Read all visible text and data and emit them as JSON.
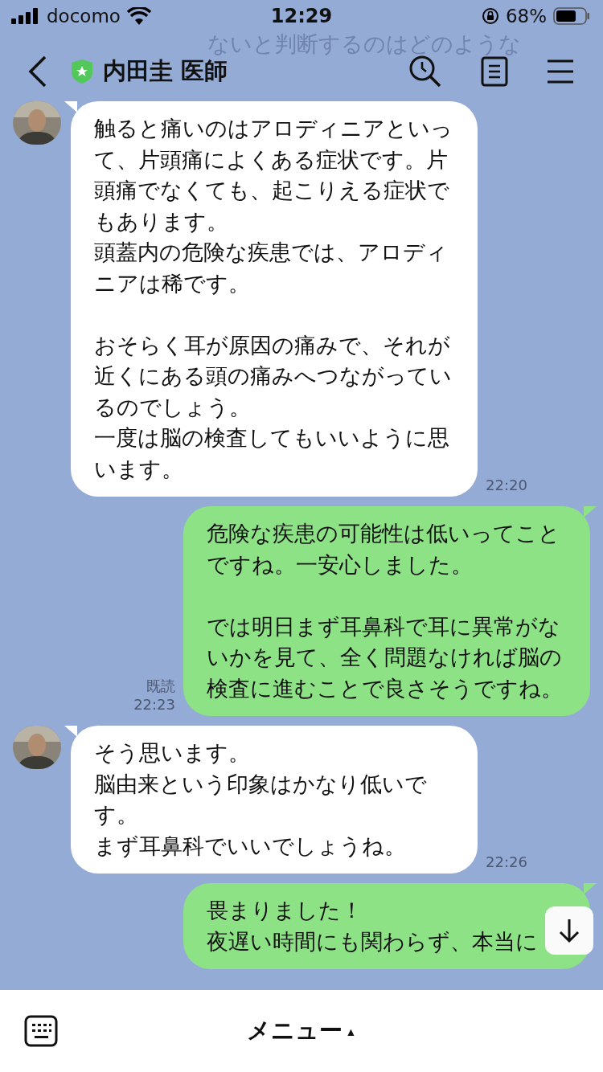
{
  "status_bar": {
    "carrier": "docomo",
    "time": "12:29",
    "battery": "68%"
  },
  "ghost_preview": {
    "text": "ないと判断するのはどのような"
  },
  "header": {
    "title": "内田圭 医師"
  },
  "messages": [
    {
      "kind": "received",
      "blocks": [
        [
          "触ると痛いのはアロディニアといって、片頭痛によくある症状です。片頭痛でなくても、起こりえる症状でもあります。",
          "頭蓋内の危険な疾患では、アロディニアは稀です。"
        ],
        [
          "おそらく耳が原因の痛みで、それが近くにある頭の痛みへつながっているのでしょう。",
          "一度は脳の検査してもいいように思います。"
        ]
      ],
      "time": "22:20"
    },
    {
      "kind": "sent",
      "blocks": [
        [
          "危険な疾患の可能性は低いってことですね。一安心しました。"
        ],
        [
          "では明日まず耳鼻科で耳に異常がないかを見て、全く問題なければ脳の検査に進むことで良さそうですね。"
        ]
      ],
      "read": "既読",
      "time": "22:23"
    },
    {
      "kind": "received",
      "blocks": [
        [
          "そう思います。",
          "脳由来という印象はかなり低いです。",
          "まず耳鼻科でいいでしょうね。"
        ]
      ],
      "time": "22:26"
    },
    {
      "kind": "sent",
      "blocks": [
        [
          "畏まりました！",
          "夜遅い時間にも関わらず、本当に"
        ]
      ]
    }
  ],
  "bottom_bar": {
    "menu": "メニュー",
    "arrow": "▲"
  }
}
